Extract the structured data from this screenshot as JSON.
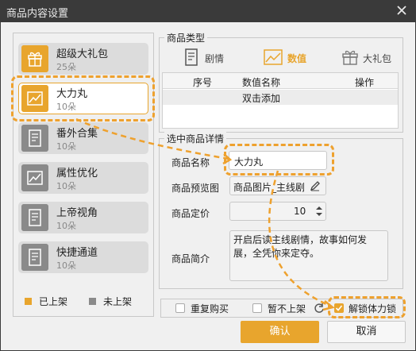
{
  "window": {
    "title": "商品内容设置"
  },
  "sidebar": {
    "items": [
      {
        "name": "超级大礼包",
        "count": "25朵",
        "state": "on",
        "icon": "gift-icon"
      },
      {
        "name": "大力丸",
        "count": "10朵",
        "state": "on",
        "icon": "chart-line-icon",
        "selected": true
      },
      {
        "name": "番外合集",
        "count": "10朵",
        "state": "off",
        "icon": "document-icon"
      },
      {
        "name": "属性优化",
        "count": "10朵",
        "state": "off",
        "icon": "chart-line-icon"
      },
      {
        "name": "上帝视角",
        "count": "10朵",
        "state": "off",
        "icon": "document-icon"
      },
      {
        "name": "快捷通道",
        "count": "10朵",
        "state": "off",
        "icon": "document-icon"
      }
    ],
    "legend": {
      "on": "已上架",
      "off": "未上架"
    }
  },
  "product_type": {
    "title": "商品类型",
    "tabs": [
      {
        "label": "剧情",
        "icon": "document-icon",
        "active": false
      },
      {
        "label": "数值",
        "icon": "chart-line-icon",
        "active": true
      },
      {
        "label": "大礼包",
        "icon": "gift-icon",
        "active": false
      }
    ],
    "table": {
      "columns": [
        "序号",
        "数值名称",
        "操作"
      ],
      "add_hint": "双击添加"
    }
  },
  "details": {
    "title": "选中商品详情",
    "name_label": "商品名称",
    "name_value": "大力丸",
    "preview_label": "商品预览图",
    "preview_value": "商品图片_主线剧",
    "price_label": "商品定价",
    "price_value": "10",
    "intro_label": "商品简介",
    "intro_value": "开启后读主线剧情，故事如何发展，全凭你来定夺。"
  },
  "options": {
    "repeat_buy": "重复购买",
    "not_listed": "暂不上架",
    "unlock_stamina": "解锁体力锁"
  },
  "buttons": {
    "ok": "确认",
    "cancel": "取消"
  },
  "colors": {
    "accent": "#e8a52d",
    "off": "#8a8a8a",
    "highlight": "#eea12e"
  }
}
